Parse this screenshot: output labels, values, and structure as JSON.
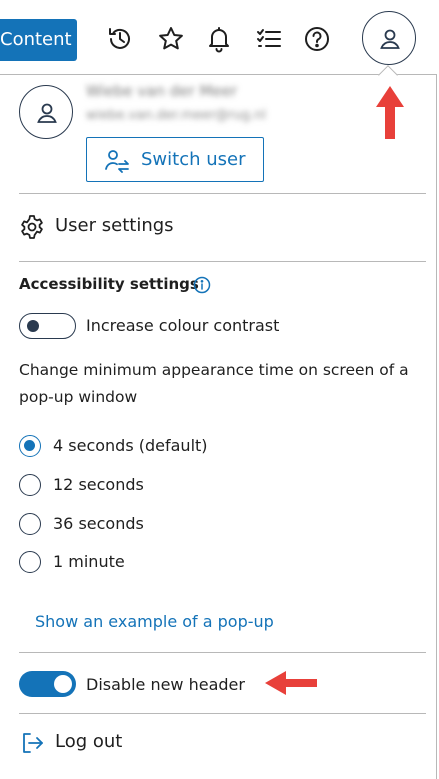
{
  "header": {
    "content_button": "Content",
    "icons": [
      "history-icon",
      "star-icon",
      "bell-icon",
      "checklist-icon",
      "help-icon",
      "user-icon"
    ]
  },
  "user": {
    "name": "Wiebe van der Meer",
    "email": "wiebe.van.der.meer@rug.nl",
    "switch_user_label": "Switch user"
  },
  "menu": {
    "user_settings_label": "User settings",
    "log_out_label": "Log out"
  },
  "accessibility": {
    "title": "Accessibility settings",
    "contrast_label": "Increase colour contrast",
    "contrast_on": false,
    "popup_description": "Change minimum appearance time on screen of a pop-up window",
    "options": [
      {
        "label": "4 seconds (default)",
        "selected": true
      },
      {
        "label": "12 seconds",
        "selected": false
      },
      {
        "label": "36 seconds",
        "selected": false
      },
      {
        "label": "1 minute",
        "selected": false
      }
    ],
    "example_link": "Show an example of a pop-up"
  },
  "header_toggle": {
    "label": "Disable new header",
    "on": true
  },
  "colors": {
    "accent": "#1473b8",
    "annotation_arrow": "#e8403a"
  }
}
